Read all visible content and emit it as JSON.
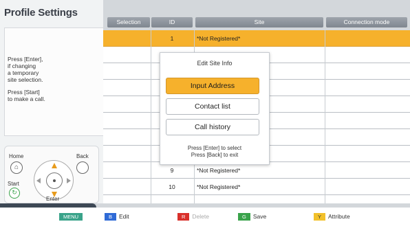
{
  "left_panel": {
    "title": "Profile Settings",
    "help_lines": [
      "Press [Enter],\nif changing\na temporary\nsite selection.",
      "Press [Start]\nto make a call."
    ],
    "remote": {
      "home_label": "Home",
      "back_label": "Back",
      "start_label": "Start",
      "enter_label": "Enter"
    }
  },
  "table": {
    "columns": [
      "Selection",
      "ID",
      "Site",
      "Connection mode"
    ],
    "rows": [
      {
        "id": "1",
        "site": "*Not Registered*"
      },
      {
        "id": "",
        "site": ""
      },
      {
        "id": "",
        "site": ""
      },
      {
        "id": "",
        "site": ""
      },
      {
        "id": "",
        "site": ""
      },
      {
        "id": "",
        "site": ""
      },
      {
        "id": "",
        "site": ""
      },
      {
        "id": "8",
        "site": "*Not Registered*"
      },
      {
        "id": "9",
        "site": "*Not Registered*"
      },
      {
        "id": "10",
        "site": "*Not Registered*"
      }
    ]
  },
  "popup": {
    "title": "Edit Site Info",
    "buttons": [
      "Input Address",
      "Contact list",
      "Call history"
    ],
    "footer_lines": [
      "Press [Enter] to select",
      "Press [Back] to exit"
    ]
  },
  "bottom_bar": {
    "keys": [
      {
        "tag": "MENU",
        "label": "",
        "color": "#3aa38a"
      },
      {
        "tag": "B",
        "label": "Edit",
        "color": "#2f6ad6"
      },
      {
        "tag": "R",
        "label": "Delete",
        "color": "#d9302b"
      },
      {
        "tag": "G",
        "label": "Save",
        "color": "#3aa34b"
      },
      {
        "tag": "Y",
        "label": "Attribute",
        "color": "#f2c12b"
      }
    ]
  },
  "colors": {
    "selection_highlight": "#f6b12c",
    "header_bg": "#8d949c",
    "panel_bg": "#f1f3f4"
  }
}
